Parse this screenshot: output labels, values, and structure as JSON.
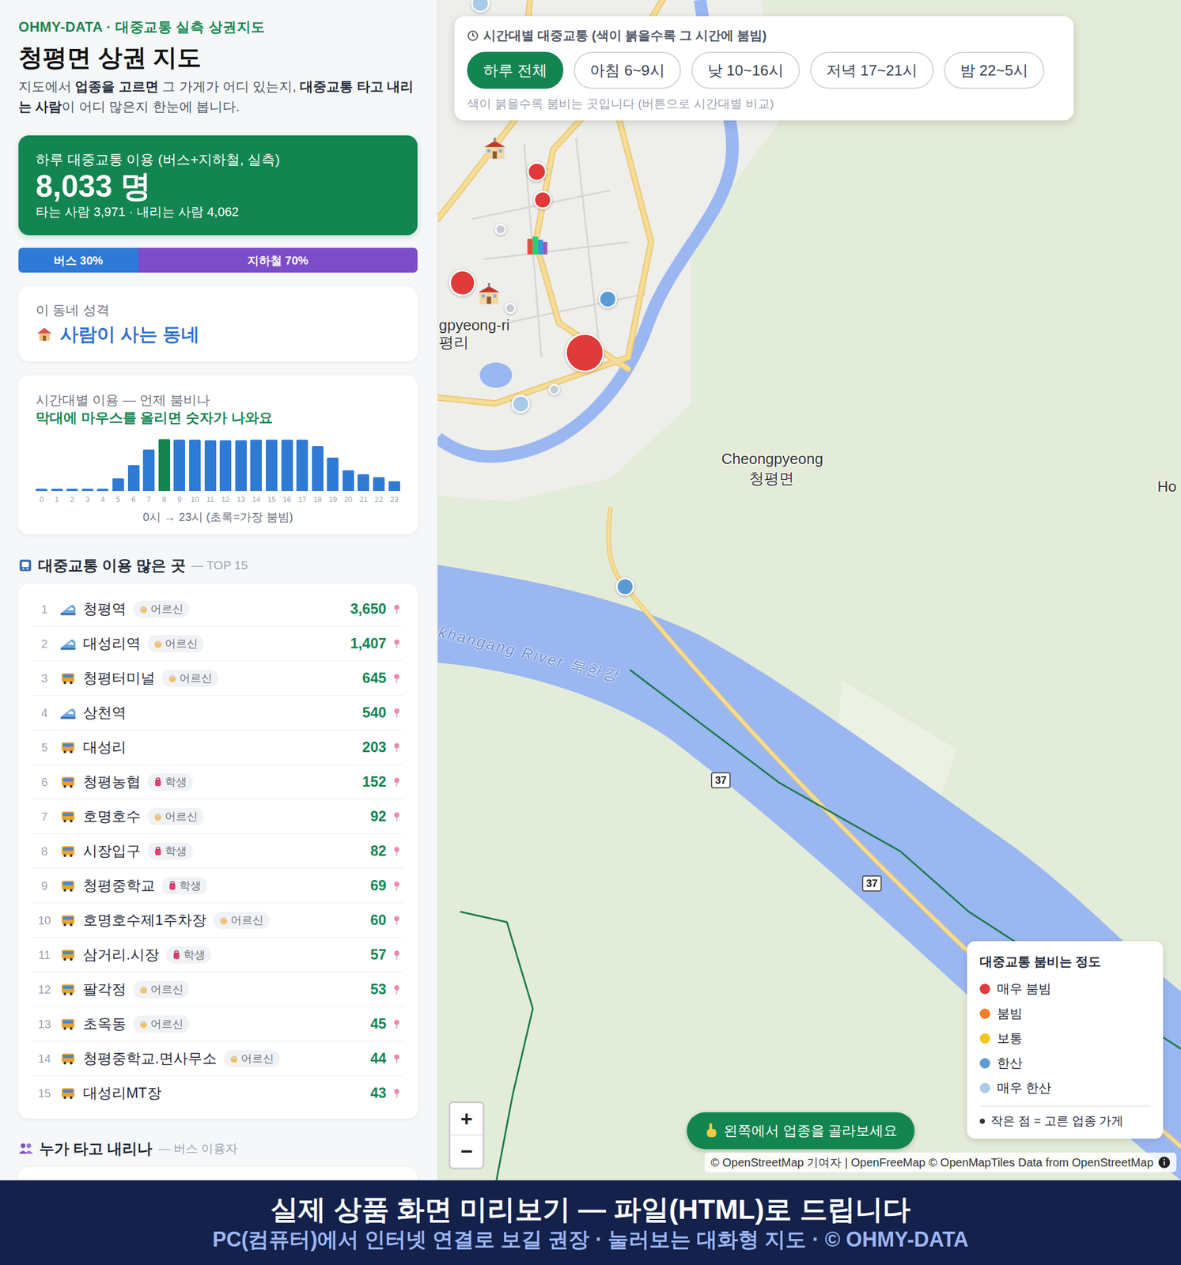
{
  "sidebar": {
    "brand": "OHMY-DATA · 대중교통 실측 상권지도",
    "title": "청평면 상권 지도",
    "description": [
      {
        "text": "지도에서 ",
        "bold": false
      },
      {
        "text": "업종을 고르면",
        "bold": true
      },
      {
        "text": " 그 가게가 어디 있는지, ",
        "bold": false
      },
      {
        "text": "대중교통 타고 내리는 사람",
        "bold": true
      },
      {
        "text": "이 어디 많은지 한눈에 봅니다.",
        "bold": false
      }
    ],
    "summary": {
      "label": "하루 대중교통 이용 (버스+지하철, 실측)",
      "total": "8,033 명",
      "detail": "타는 사람 3,971 · 내리는 사람 4,062"
    },
    "mode_split": [
      {
        "label": "버스 30%",
        "level": 0.3,
        "color": "#2f7ad6"
      },
      {
        "label": "지하철 70%",
        "level": 0.7,
        "color": "#7c4dc9"
      }
    ],
    "character": {
      "label": "이 동네 성격",
      "value": "사람이 사는 동네"
    },
    "hourly_chart": {
      "title": "시간대별 이용 — 언제 붐비나",
      "hint": "막대에 마우스를 올리면 숫자가 나와요",
      "values": [
        26,
        26,
        26,
        26,
        26,
        138,
        277,
        450,
        560,
        553,
        553,
        545,
        545,
        545,
        553,
        553,
        553,
        553,
        484,
        363,
        225,
        182,
        147,
        104
      ],
      "highlighted_index": 8,
      "ticks": [
        "0",
        "1",
        "2",
        "3",
        "4",
        "5",
        "6",
        "7",
        "8",
        "9",
        "10",
        "11",
        "12",
        "13",
        "14",
        "15",
        "16",
        "17",
        "18",
        "19",
        "20",
        "21",
        "22",
        "23"
      ],
      "caption": "0시 → 23시 (초록=가장 붐빔)"
    },
    "top_heading": {
      "title": "대중교통 이용 많은 곳",
      "suffix": "— TOP 15"
    },
    "top_stops": [
      {
        "rank": "1",
        "kind": "subway",
        "name": "청평역",
        "tag": {
          "text": "어르신",
          "kind": "senior"
        },
        "count": "3,650"
      },
      {
        "rank": "2",
        "kind": "subway",
        "name": "대성리역",
        "tag": {
          "text": "어르신",
          "kind": "senior"
        },
        "count": "1,407"
      },
      {
        "rank": "3",
        "kind": "bus",
        "name": "청평터미널",
        "tag": {
          "text": "어르신",
          "kind": "senior"
        },
        "count": "645"
      },
      {
        "rank": "4",
        "kind": "subway",
        "name": "상천역",
        "tag": null,
        "count": "540"
      },
      {
        "rank": "5",
        "kind": "bus",
        "name": "대성리",
        "tag": null,
        "count": "203"
      },
      {
        "rank": "6",
        "kind": "bus",
        "name": "청평농협",
        "tag": {
          "text": "학생",
          "kind": "student"
        },
        "count": "152"
      },
      {
        "rank": "7",
        "kind": "bus",
        "name": "호명호수",
        "tag": {
          "text": "어르신",
          "kind": "senior"
        },
        "count": "92"
      },
      {
        "rank": "8",
        "kind": "bus",
        "name": "시장입구",
        "tag": {
          "text": "학생",
          "kind": "student"
        },
        "count": "82"
      },
      {
        "rank": "9",
        "kind": "bus",
        "name": "청평중학교",
        "tag": {
          "text": "학생",
          "kind": "student"
        },
        "count": "69"
      },
      {
        "rank": "10",
        "kind": "bus",
        "name": "호명호수제1주차장",
        "tag": {
          "text": "어르신",
          "kind": "senior"
        },
        "count": "60"
      },
      {
        "rank": "11",
        "kind": "bus",
        "name": "삼거리.시장",
        "tag": {
          "text": "학생",
          "kind": "student"
        },
        "count": "57"
      },
      {
        "rank": "12",
        "kind": "bus",
        "name": "팔각정",
        "tag": {
          "text": "어르신",
          "kind": "senior"
        },
        "count": "53"
      },
      {
        "rank": "13",
        "kind": "bus",
        "name": "초옥동",
        "tag": {
          "text": "어르신",
          "kind": "senior"
        },
        "count": "45"
      },
      {
        "rank": "14",
        "kind": "bus",
        "name": "청평중학교.면사무소",
        "tag": {
          "text": "어르신",
          "kind": "senior"
        },
        "count": "44"
      },
      {
        "rank": "15",
        "kind": "bus",
        "name": "대성리MT장",
        "tag": null,
        "count": "43"
      }
    ],
    "riders_heading": {
      "title": "누가 타고 내리나",
      "suffix": "— 버스 이용자"
    }
  },
  "map": {
    "time_filter": {
      "title": "시간대별 대중교통 (색이 붉을수록 그 시간에 붐빔)",
      "options": [
        {
          "label": "하루 전체",
          "selected": true
        },
        {
          "label": "아침 6~9시",
          "selected": false
        },
        {
          "label": "낮 10~16시",
          "selected": false
        },
        {
          "label": "저녁 17~21시",
          "selected": false
        },
        {
          "label": "밤 22~5시",
          "selected": false
        }
      ],
      "hint": "색이 붉을수록 붐비는 곳입니다 (버튼으로 시간대별 비교)"
    },
    "stops": [
      {
        "color": "#a9cbe8",
        "level": 0.35
      },
      {
        "color": "#e03a3a",
        "level": 0.4
      },
      {
        "color": "#e03a3a",
        "level": 0.35
      },
      {
        "color": "#e03a3a",
        "level": 0.6
      },
      {
        "color": "#e03a3a",
        "level": 1.0
      },
      {
        "color": "#c5ccd6",
        "level": 0.15
      },
      {
        "color": "#c5ccd6",
        "level": 0.15
      },
      {
        "color": "#c5ccd6",
        "level": 0.15
      },
      {
        "color": "#5b9bd5",
        "level": 0.35
      },
      {
        "color": "#a9cbe8",
        "level": 0.35
      },
      {
        "color": "#5b9bd5",
        "level": 0.35
      }
    ],
    "place_labels": [
      {
        "text": "Cheongpyeong"
      },
      {
        "text": "청평면"
      },
      {
        "text": "gpyeong-ri"
      },
      {
        "text": "평리"
      },
      {
        "text": "Ho"
      }
    ],
    "river_label": "khangang River 북한강",
    "route_shields": [
      "37",
      "37"
    ],
    "zoom": {
      "in": "+",
      "out": "−"
    },
    "cta": "왼쪽에서 업종을 골라보세요",
    "legend": {
      "title": "대중교통 붐비는 정도",
      "items": [
        {
          "label": "매우 붐빔",
          "color": "#e03a3a"
        },
        {
          "label": "붐빔",
          "color": "#f57c2a"
        },
        {
          "label": "보통",
          "color": "#f6c51b"
        },
        {
          "label": "한산",
          "color": "#5b9bd5"
        },
        {
          "label": "매우 한산",
          "color": "#a9cbe8"
        }
      ],
      "note": "작은 점 = 고른 업종 가게"
    },
    "attribution": "© OpenStreetMap 기여자 | OpenFreeMap © OpenMapTiles Data from OpenStreetMap"
  },
  "banner": {
    "title": "실제 상품 화면 미리보기 — 파일(HTML)로 드립니다",
    "subtitle": "PC(컴퓨터)에서 인터넷 연결로 보길 권장 · 눌러보는 대화형 지도 · © OHMY-DATA"
  }
}
